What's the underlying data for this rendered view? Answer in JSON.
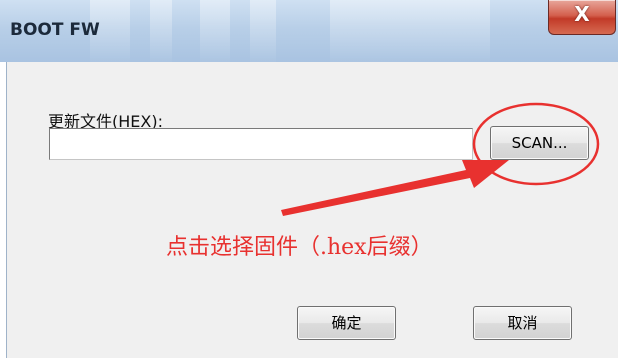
{
  "window": {
    "title": "BOOT FW",
    "close_label": "X"
  },
  "form": {
    "file_label": "更新文件(HEX):",
    "file_value": "",
    "scan_label": "SCAN..."
  },
  "buttons": {
    "ok_label": "确定",
    "cancel_label": "取消"
  },
  "annotation": {
    "text": "点击选择固件（.hex后缀）",
    "color": "#e8312f"
  },
  "colors": {
    "titlebar": "#b8cfe8",
    "close_button": "#c23a28",
    "client_bg": "#f0f0f0"
  }
}
